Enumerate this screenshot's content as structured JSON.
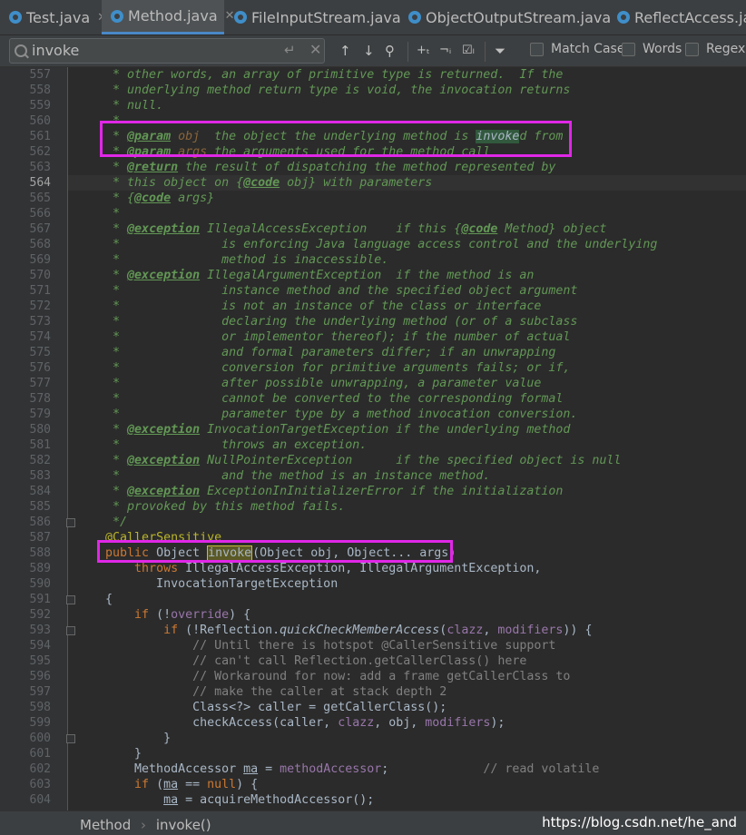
{
  "tabs": [
    {
      "label": "Test.java",
      "active": false
    },
    {
      "label": "Method.java",
      "active": true
    },
    {
      "label": "FileInputStream.java",
      "active": false
    },
    {
      "label": "ObjectOutputStream.java",
      "active": false
    },
    {
      "label": "ReflectAccess.java",
      "active": false
    }
  ],
  "search": {
    "value": "invoke",
    "placeholder": ""
  },
  "options": {
    "match_case": "Match Case",
    "words": "Words",
    "regex": "Regex"
  },
  "current_line": "564",
  "lines": [
    {
      "n": "557",
      "t": "     * other words, an array of primitive type is returned.  If the"
    },
    {
      "n": "558",
      "t": "     * underlying method return type is void, the invocation returns"
    },
    {
      "n": "559",
      "t": "     * null."
    },
    {
      "n": "560",
      "t": "     *"
    },
    {
      "n": "561",
      "t": "     * @param obj  the object the underlying method is invoked from"
    },
    {
      "n": "562",
      "t": "     * @param args the arguments used for the method call"
    },
    {
      "n": "563",
      "t": "     * @return the result of dispatching the method represented by"
    },
    {
      "n": "564",
      "t": "     * this object on {@code obj} with parameters"
    },
    {
      "n": "565",
      "t": "     * {@code args}"
    },
    {
      "n": "566",
      "t": "     *"
    },
    {
      "n": "567",
      "t": "     * @exception IllegalAccessException    if this {@code Method} object"
    },
    {
      "n": "568",
      "t": "     *              is enforcing Java language access control and the underlying"
    },
    {
      "n": "569",
      "t": "     *              method is inaccessible."
    },
    {
      "n": "570",
      "t": "     * @exception IllegalArgumentException  if the method is an"
    },
    {
      "n": "571",
      "t": "     *              instance method and the specified object argument"
    },
    {
      "n": "572",
      "t": "     *              is not an instance of the class or interface"
    },
    {
      "n": "573",
      "t": "     *              declaring the underlying method (or of a subclass"
    },
    {
      "n": "574",
      "t": "     *              or implementor thereof); if the number of actual"
    },
    {
      "n": "575",
      "t": "     *              and formal parameters differ; if an unwrapping"
    },
    {
      "n": "576",
      "t": "     *              conversion for primitive arguments fails; or if,"
    },
    {
      "n": "577",
      "t": "     *              after possible unwrapping, a parameter value"
    },
    {
      "n": "578",
      "t": "     *              cannot be converted to the corresponding formal"
    },
    {
      "n": "579",
      "t": "     *              parameter type by a method invocation conversion."
    },
    {
      "n": "580",
      "t": "     * @exception InvocationTargetException if the underlying method"
    },
    {
      "n": "581",
      "t": "     *              throws an exception."
    },
    {
      "n": "582",
      "t": "     * @exception NullPointerException      if the specified object is null"
    },
    {
      "n": "583",
      "t": "     *              and the method is an instance method."
    },
    {
      "n": "584",
      "t": "     * @exception ExceptionInInitializerError if the initialization"
    },
    {
      "n": "585",
      "t": "     * provoked by this method fails."
    },
    {
      "n": "586",
      "t": "     */"
    },
    {
      "n": "587",
      "t": "    @CallerSensitive"
    },
    {
      "n": "588",
      "t": "    public Object invoke(Object obj, Object... args)"
    },
    {
      "n": "589",
      "t": "        throws IllegalAccessException, IllegalArgumentException,"
    },
    {
      "n": "590",
      "t": "           InvocationTargetException"
    },
    {
      "n": "591",
      "t": "    {"
    },
    {
      "n": "592",
      "t": "        if (!override) {"
    },
    {
      "n": "593",
      "t": "            if (!Reflection.quickCheckMemberAccess(clazz, modifiers)) {"
    },
    {
      "n": "594",
      "t": "                // Until there is hotspot @CallerSensitive support"
    },
    {
      "n": "595",
      "t": "                // can't call Reflection.getCallerClass() here"
    },
    {
      "n": "596",
      "t": "                // Workaround for now: add a frame getCallerClass to"
    },
    {
      "n": "597",
      "t": "                // make the caller at stack depth 2"
    },
    {
      "n": "598",
      "t": "                Class<?> caller = getCallerClass();"
    },
    {
      "n": "599",
      "t": "                checkAccess(caller, clazz, obj, modifiers);"
    },
    {
      "n": "600",
      "t": "            }"
    },
    {
      "n": "601",
      "t": "        }"
    },
    {
      "n": "602",
      "t": "        MethodAccessor ma = methodAccessor;             // read volatile"
    },
    {
      "n": "603",
      "t": "        if (ma == null) {"
    },
    {
      "n": "604",
      "t": "            ma = acquireMethodAccessor();"
    }
  ],
  "breadcrumb": {
    "class": "Method",
    "method": "invoke()"
  },
  "watermark": "https://blog.csdn.net/he_and",
  "icons": {
    "search": "search-icon",
    "enter": "enter-icon",
    "clear": "clear-icon",
    "up": "arrow-up-icon",
    "down": "arrow-down-icon",
    "find-all": "find-all-icon",
    "add-occurrence": "add-occurrence-icon",
    "remove-occurrence": "remove-occurrence-icon",
    "select-all": "select-all-occurrences-icon",
    "filter": "filter-icon"
  },
  "colors": {
    "highlight_box": "#e027e7",
    "keyword": "#cc7832",
    "doc": "#629755",
    "field": "#9876aa"
  }
}
